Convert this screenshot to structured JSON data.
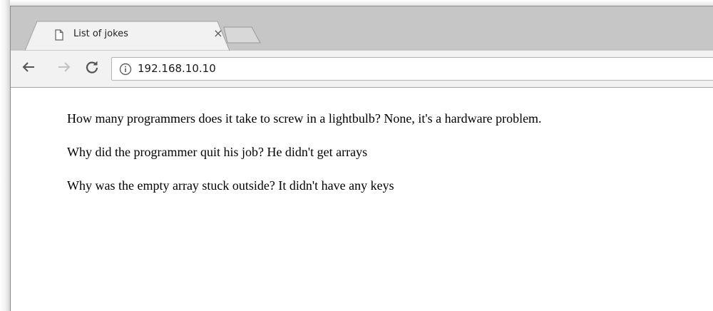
{
  "browser": {
    "tab": {
      "title": "List of jokes",
      "close_glyph": "×",
      "favicon": "page-icon"
    },
    "new_tab": "new-tab-icon",
    "nav": {
      "back": "back-arrow-icon",
      "forward": "forward-arrow-icon",
      "reload": "reload-icon"
    },
    "address_bar": {
      "security_icon": "info-icon",
      "url": "192.168.10.10"
    }
  },
  "page": {
    "jokes": [
      "How many programmers does it take to screw in a lightbulb? None, it's a hardware problem.",
      "Why did the programmer quit his job? He didn't get arrays",
      "Why was the empty array stuck outside? It didn't have any keys"
    ]
  },
  "colors": {
    "tabstrip": "#c6c6c6",
    "toolbar": "#f2f2f2",
    "page_background": "#ffffff",
    "text": "#000000"
  }
}
